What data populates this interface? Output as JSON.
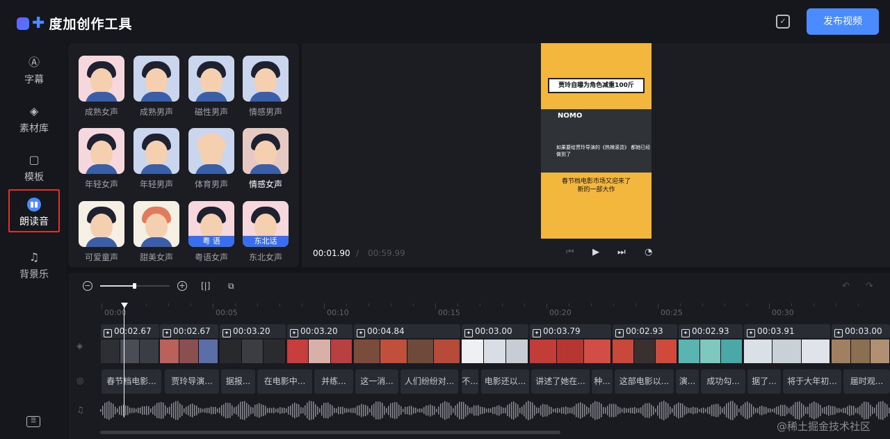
{
  "app": {
    "title": "度加创作工具",
    "publish_label": "发布视频"
  },
  "sidebar": {
    "items": [
      {
        "label": "字幕",
        "icon": "text-A-icon"
      },
      {
        "label": "素材库",
        "icon": "layers-icon"
      },
      {
        "label": "模板",
        "icon": "template-icon"
      },
      {
        "label": "朗读音",
        "icon": "voice-icon",
        "active": true
      },
      {
        "label": "背景乐",
        "icon": "music-icon"
      }
    ]
  },
  "voices": [
    {
      "name": "成熟女声",
      "hair": "#1e2230",
      "bg": "#f7d7de"
    },
    {
      "name": "成熟男声",
      "hair": "#1e2230",
      "bg": "#c9d6ee"
    },
    {
      "name": "磁性男声",
      "hair": "#1e2230",
      "bg": "#c9d6ee"
    },
    {
      "name": "情感男声",
      "hair": "#1e2230",
      "bg": "#c9d6ee"
    },
    {
      "name": "年轻女声",
      "hair": "#1e2230",
      "bg": "#f7d7de"
    },
    {
      "name": "年轻男声",
      "hair": "#1e2230",
      "bg": "#c9d6ee"
    },
    {
      "name": "体育男声",
      "hair": "#f4cfb0",
      "bg": "#c9d6ee"
    },
    {
      "name": "情感女声",
      "hair": "#1e2230",
      "bg": "#e7c9c4",
      "highlight": true
    },
    {
      "name": "可爱童声",
      "hair": "#1e2230",
      "bg": "#f6efe4"
    },
    {
      "name": "甜美女声",
      "hair": "#e07b5b",
      "bg": "#f6efe4"
    },
    {
      "name": "粤语女声",
      "hair": "#1e2230",
      "bg": "#f7d7de",
      "tag": "粤 语"
    },
    {
      "name": "东北女声",
      "hair": "#1e2230",
      "bg": "#f7d7de",
      "tag": "东北话"
    }
  ],
  "preview": {
    "banner": "贾玲自曝为角色减重100斤",
    "video_logo": "NOMO",
    "video_caption": "如果要给贾玲导演的《热辣滚烫》 都她已经做到了",
    "caption_line1": "春节档电影市场又迎来了",
    "caption_line2": "新的一部大作",
    "current_time": "00:01.90",
    "separator": "/",
    "total_time": "00:59.99"
  },
  "ruler": [
    "00:00",
    "00:05",
    "00:10",
    "00:15",
    "00:20",
    "00:25",
    "00:30"
  ],
  "clips": [
    {
      "duration": "00:02.67",
      "colors": [
        "#2d2f35",
        "#4a4d55",
        "#3a3d44"
      ]
    },
    {
      "duration": "00:02.67",
      "colors": [
        "#b9615a",
        "#8a5050",
        "#5b6ea8"
      ]
    },
    {
      "duration": "00:03.20",
      "colors": [
        "#28292d",
        "#3b3d42",
        "#2a2b2f"
      ]
    },
    {
      "duration": "00:03.20",
      "colors": [
        "#c83d3d",
        "#d9b0a8",
        "#b84040"
      ]
    },
    {
      "duration": "00:04.84",
      "colors": [
        "#7a4c3c",
        "#c0503c",
        "#6e4a3a",
        "#b84a3a"
      ]
    },
    {
      "duration": "00:03.00",
      "colors": [
        "#eef0f4",
        "#d8dde6",
        "#c8ccd4"
      ]
    },
    {
      "duration": "00:03.79",
      "colors": [
        "#c23d38",
        "#b83632",
        "#d24d45"
      ]
    },
    {
      "duration": "00:02.93",
      "colors": [
        "#c8483a",
        "#3a3030",
        "#d04a3c"
      ]
    },
    {
      "duration": "00:02.93",
      "colors": [
        "#5ab5b2",
        "#7ec8c0",
        "#4aa9a8"
      ]
    },
    {
      "duration": "00:03.91",
      "colors": [
        "#d9e0e8",
        "#c9d0d8",
        "#e0e4ea"
      ]
    },
    {
      "duration": "00:03.00",
      "colors": [
        "#a08060",
        "#8a7050",
        "#b09070"
      ]
    }
  ],
  "subtitles": [
    "春节档电影...",
    "贾玲导演...",
    "据报...",
    "在电影中...",
    "并练...",
    "这一消...",
    "人们纷纷对...",
    "不...",
    "电影还以...",
    "讲述了她在...",
    "种...",
    "这部电影以...",
    "演...",
    "成功勾...",
    "据了...",
    "将于大年初...",
    "届时观..."
  ],
  "watermark": "@稀土掘金技术社区"
}
